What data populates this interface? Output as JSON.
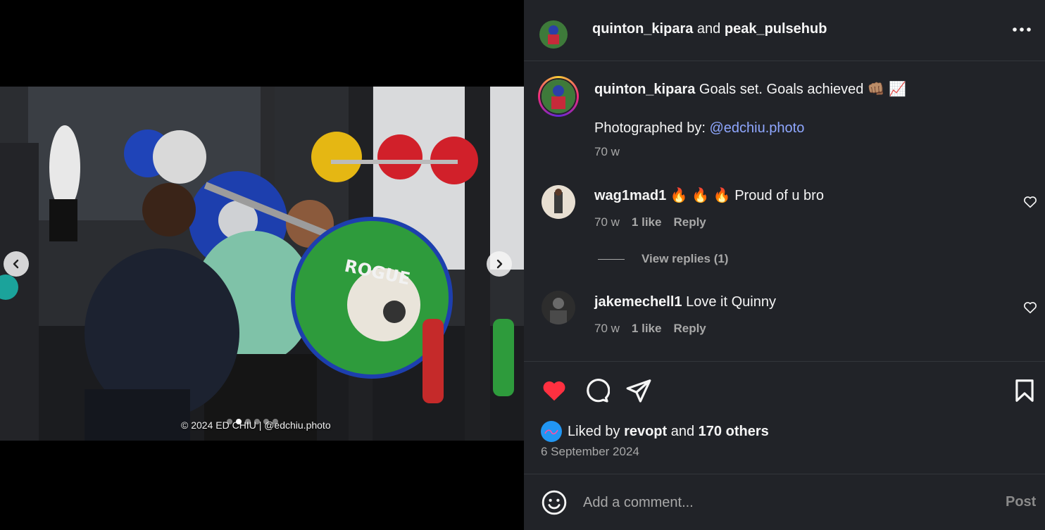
{
  "post": {
    "copyright": "© 2024 ED CHIU | @edchiu.photo",
    "slide_count": 6,
    "active_slide": 2
  },
  "header": {
    "author": "quinton_kipara",
    "joiner": "and",
    "collaborator": "peak_pulsehub",
    "more_icon": "more-horizontal-icon"
  },
  "caption": {
    "username": "quinton_kipara",
    "text": "Goals set. Goals achieved 👊🏽 📈",
    "credit_prefix": "Photographed by: ",
    "credit_handle": "@edchiu.photo",
    "age": "70 w"
  },
  "comments": [
    {
      "username": "wag1mad1",
      "text": "🔥 🔥 🔥  Proud of u bro",
      "age": "70 w",
      "likes": "1 like",
      "reply_label": "Reply",
      "view_replies": "View replies (1)"
    },
    {
      "username": "jakemechell1",
      "text": "Love it Quinny",
      "age": "70 w",
      "likes": "1 like",
      "reply_label": "Reply"
    }
  ],
  "actions": {
    "liked": true,
    "liked_by_prefix": "Liked by ",
    "liked_by_user": "revopt",
    "liked_by_join": " and ",
    "liked_by_others": "170 others",
    "date": "6 September 2024"
  },
  "composer": {
    "placeholder": "Add a comment...",
    "post_label": "Post"
  },
  "colors": {
    "panel_bg": "#212328",
    "like_red": "#ff3040",
    "link_blue": "#8fa7ff",
    "muted": "#a8a8a8"
  }
}
